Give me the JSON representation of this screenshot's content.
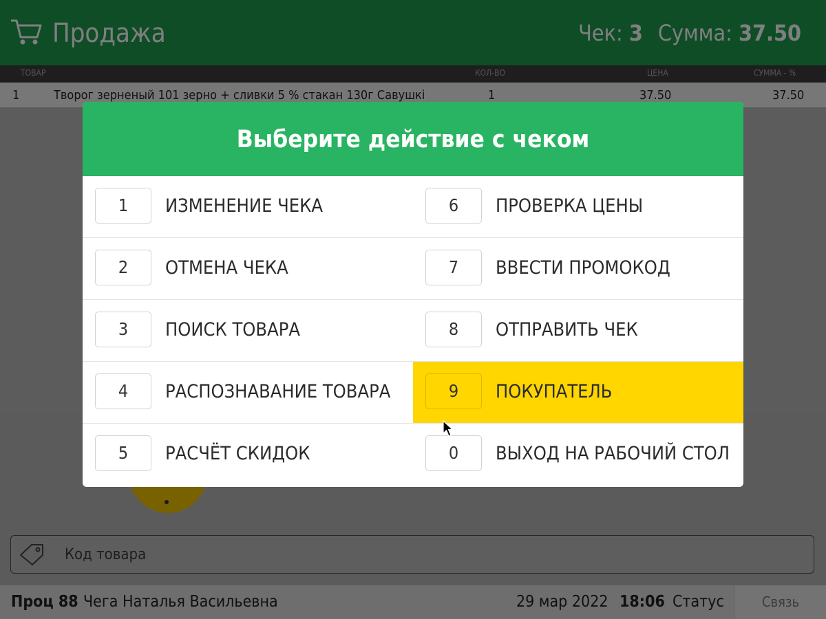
{
  "header": {
    "title": "Продажа",
    "check_label": "Чек:",
    "check_number": "3",
    "sum_label": "Сумма:",
    "sum_value": "37.50",
    "icon": "cart-icon"
  },
  "table": {
    "columns": [
      "ТОВАР",
      "КОЛ-ВО",
      "ЦЕНА",
      "СУММА - %"
    ],
    "rows": [
      {
        "num": "1",
        "name": "Творог зерненый 101 зерно + сливки 5 % стакан 130г Савушкі",
        "qty": "1",
        "price": "37.50",
        "sum": "37.50"
      }
    ]
  },
  "product_code": {
    "placeholder": "Код товара",
    "icon": "tag-icon"
  },
  "statusbar": {
    "proc": "Проц 88",
    "user": "Чега Наталья Васильевна",
    "date": "29 мар 2022",
    "time": "18:06",
    "status": "Статус",
    "link": "Связь"
  },
  "modal": {
    "title": "Выберите действие с чеком",
    "options": [
      {
        "key": "1",
        "label": "ИЗМЕНЕНИЕ ЧЕКА"
      },
      {
        "key": "2",
        "label": "ОТМЕНА ЧЕКА"
      },
      {
        "key": "3",
        "label": "ПОИСК ТОВАРА"
      },
      {
        "key": "4",
        "label": "РАСПОЗНАВАНИЕ ТОВАРА"
      },
      {
        "key": "5",
        "label": "РАСЧЁТ СКИДОК"
      },
      {
        "key": "6",
        "label": "ПРОВЕРКА ЦЕНЫ"
      },
      {
        "key": "7",
        "label": "ВВЕСТИ ПРОМОКОД"
      },
      {
        "key": "8",
        "label": "ОТПРАВИТЬ ЧЕК"
      },
      {
        "key": "9",
        "label": "ПОКУПАТЕЛЬ"
      },
      {
        "key": "0",
        "label": "ВЫХОД НА РАБОЧИЙ СТОЛ"
      }
    ],
    "selected_key": "9"
  },
  "colors": {
    "header_green": "#1e9a4e",
    "modal_header_green": "#28b462",
    "selected_yellow": "#ffd600"
  }
}
